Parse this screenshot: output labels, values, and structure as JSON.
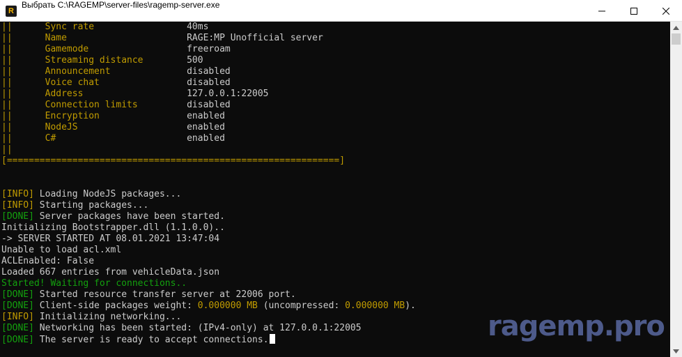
{
  "window": {
    "title": "Выбрать C:\\RAGEMP\\server-files\\ragemp-server.exe"
  },
  "colors": {
    "info": "#c19c00",
    "done": "#13a10e",
    "text": "#cccccc",
    "background": "#0c0c0c"
  },
  "icons": {
    "app": "ragemp-logo",
    "minimize": "minimize-icon",
    "maximize": "maximize-icon",
    "close": "close-icon"
  },
  "console": {
    "lines": [
      [
        {
          "t": "||",
          "c": "yellow"
        },
        {
          "t": "      Sync rate                 ",
          "c": "yellow"
        },
        {
          "t": "40ms",
          "c": "gray"
        }
      ],
      [
        {
          "t": "||",
          "c": "yellow"
        },
        {
          "t": "      Name                      ",
          "c": "yellow"
        },
        {
          "t": "RAGE:MP Unofficial server",
          "c": "gray"
        }
      ],
      [
        {
          "t": "||",
          "c": "yellow"
        },
        {
          "t": "      Gamemode                  ",
          "c": "yellow"
        },
        {
          "t": "freeroam",
          "c": "gray"
        }
      ],
      [
        {
          "t": "||",
          "c": "yellow"
        },
        {
          "t": "      Streaming distance        ",
          "c": "yellow"
        },
        {
          "t": "500",
          "c": "gray"
        }
      ],
      [
        {
          "t": "||",
          "c": "yellow"
        },
        {
          "t": "      Announcement              ",
          "c": "yellow"
        },
        {
          "t": "disabled",
          "c": "gray"
        }
      ],
      [
        {
          "t": "||",
          "c": "yellow"
        },
        {
          "t": "      Voice chat                ",
          "c": "yellow"
        },
        {
          "t": "disabled",
          "c": "gray"
        }
      ],
      [
        {
          "t": "||",
          "c": "yellow"
        },
        {
          "t": "      Address                   ",
          "c": "yellow"
        },
        {
          "t": "127.0.0.1:22005",
          "c": "gray"
        }
      ],
      [
        {
          "t": "||",
          "c": "yellow"
        },
        {
          "t": "      Connection limits         ",
          "c": "yellow"
        },
        {
          "t": "disabled",
          "c": "gray"
        }
      ],
      [
        {
          "t": "||",
          "c": "yellow"
        },
        {
          "t": "      Encryption                ",
          "c": "yellow"
        },
        {
          "t": "enabled",
          "c": "gray"
        }
      ],
      [
        {
          "t": "||",
          "c": "yellow"
        },
        {
          "t": "      NodeJS                    ",
          "c": "yellow"
        },
        {
          "t": "enabled",
          "c": "gray"
        }
      ],
      [
        {
          "t": "||",
          "c": "yellow"
        },
        {
          "t": "      C#                        ",
          "c": "yellow"
        },
        {
          "t": "enabled",
          "c": "gray"
        }
      ],
      [
        {
          "t": "||",
          "c": "yellow"
        }
      ],
      [
        {
          "t": "[=============================================================]",
          "c": "yellow"
        }
      ],
      [],
      [],
      [
        {
          "t": "[INFO]",
          "c": "yellow"
        },
        {
          "t": " Loading NodeJS packages...",
          "c": "gray"
        }
      ],
      [
        {
          "t": "[INFO]",
          "c": "yellow"
        },
        {
          "t": " Starting packages...",
          "c": "gray"
        }
      ],
      [
        {
          "t": "[DONE]",
          "c": "green"
        },
        {
          "t": " Server packages have been started.",
          "c": "gray"
        }
      ],
      [
        {
          "t": "Initializing Bootstrapper.dll (1.1.0.0)..",
          "c": "gray"
        }
      ],
      [
        {
          "t": "-> SERVER STARTED AT 08.01.2021 13:47:04",
          "c": "gray"
        }
      ],
      [
        {
          "t": "Unable to load acl.xml",
          "c": "gray"
        }
      ],
      [
        {
          "t": "ACLEnabled: False",
          "c": "gray"
        }
      ],
      [
        {
          "t": "Loaded 667 entries from vehicleData.json",
          "c": "gray"
        }
      ],
      [
        {
          "t": "Started! Waiting for connections..",
          "c": "green"
        }
      ],
      [
        {
          "t": "[DONE]",
          "c": "green"
        },
        {
          "t": " Started resource transfer server at 22006 port.",
          "c": "gray"
        }
      ],
      [
        {
          "t": "[DONE]",
          "c": "green"
        },
        {
          "t": " Client-side packages weight: ",
          "c": "gray"
        },
        {
          "t": "0.000000 MB",
          "c": "yellow"
        },
        {
          "t": " (uncompressed: ",
          "c": "gray"
        },
        {
          "t": "0.000000 MB",
          "c": "yellow"
        },
        {
          "t": ").",
          "c": "gray"
        }
      ],
      [
        {
          "t": "[INFO]",
          "c": "yellow"
        },
        {
          "t": " Initializing networking...",
          "c": "gray"
        }
      ],
      [
        {
          "t": "[DONE]",
          "c": "green"
        },
        {
          "t": " Networking has been started: (IPv4-only) at 127.0.0.1:22005",
          "c": "gray"
        }
      ],
      [
        {
          "t": "[DONE]",
          "c": "green"
        },
        {
          "t": " The server is ready to accept connections.",
          "c": "gray"
        }
      ]
    ]
  },
  "watermark": {
    "text": "ragemp.pro"
  }
}
